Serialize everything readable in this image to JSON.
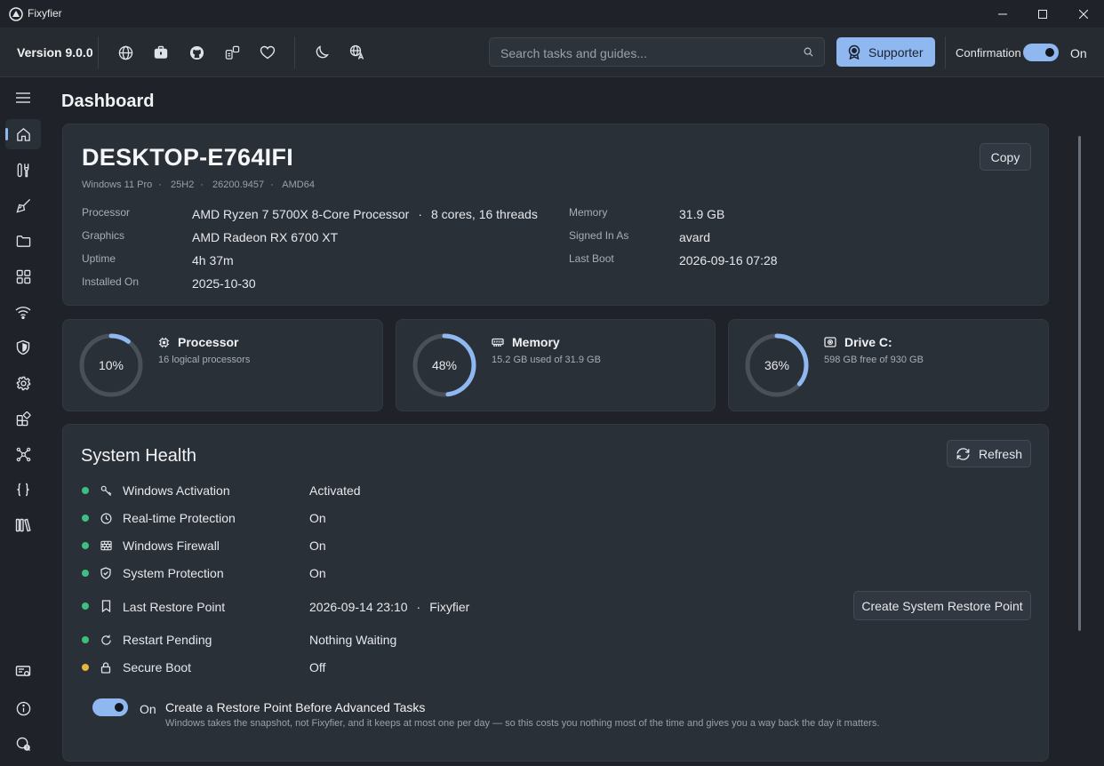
{
  "window": {
    "title": "Fixyfier"
  },
  "toolbar": {
    "version": "Version 9.0.0",
    "search_placeholder": "Search tasks and guides...",
    "supporter_label": "Supporter",
    "confirmation_label": "Confirmation",
    "confirmation_state": "On"
  },
  "page": {
    "title": "Dashboard"
  },
  "system": {
    "hostname": "DESKTOP-E764IFI",
    "os": [
      "Windows 11 Pro",
      "25H2",
      "26200.9457",
      "AMD64"
    ],
    "copy_label": "Copy",
    "processor_label": "Processor",
    "processor_value": "AMD Ryzen 7 5700X 8-Core Processor",
    "processor_extra": "8 cores, 16 threads",
    "graphics_label": "Graphics",
    "graphics_value": "AMD Radeon RX 6700 XT",
    "uptime_label": "Uptime",
    "uptime_value": "4h 37m",
    "installed_label": "Installed On",
    "installed_value": "2025-10-30",
    "memory_label": "Memory",
    "memory_value": "31.9 GB",
    "signed_label": "Signed In As",
    "signed_value": "avard",
    "boot_label": "Last Boot",
    "boot_value": "2026-09-16 07:28"
  },
  "stats": [
    {
      "title": "Processor",
      "subtitle": "16 logical processors",
      "percent_label": "10%",
      "fraction": 0.1,
      "icon": "cpu-icon"
    },
    {
      "title": "Memory",
      "subtitle": "15.2 GB used of 31.9 GB",
      "percent_label": "48%",
      "fraction": 0.48,
      "icon": "memory-icon"
    },
    {
      "title": "Drive C:",
      "subtitle": "598 GB free of 930 GB",
      "percent_label": "36%",
      "fraction": 0.36,
      "icon": "drive-icon"
    }
  ],
  "health": {
    "title": "System Health",
    "refresh_label": "Refresh",
    "restore_button_label": "Create System Restore Point",
    "items": [
      {
        "label": "Windows Activation",
        "value": "Activated",
        "status_color": "#3fbf7f",
        "icon": "key-icon"
      },
      {
        "label": "Real-time Protection",
        "value": "On",
        "status_color": "#3fbf7f",
        "icon": "clock-icon"
      },
      {
        "label": "Windows Firewall",
        "value": "On",
        "status_color": "#3fbf7f",
        "icon": "firewall-icon"
      },
      {
        "label": "System Protection",
        "value": "On",
        "status_color": "#3fbf7f",
        "icon": "shield-check-icon"
      },
      {
        "label": "Last Restore Point",
        "value": "2026-09-14 23:10",
        "extra": "Fixyfier",
        "status_color": "#3fbf7f",
        "icon": "bookmark-icon"
      },
      {
        "label": "Restart Pending",
        "value": "Nothing Waiting",
        "status_color": "#3fbf7f",
        "icon": "restart-icon"
      },
      {
        "label": "Secure Boot",
        "value": "Off",
        "status_color": "#e8b43a",
        "icon": "lock-icon"
      }
    ],
    "advanced_toggle_state": "On",
    "advanced_title": "Create a Restore Point Before Advanced Tasks",
    "advanced_desc": "Windows takes the snapshot, not Fixyfier, and it keeps at most one per day — so this costs you nothing most of the time and gives you a way back the day it matters."
  },
  "colors": {
    "accent": "#8fb8f0",
    "ok": "#3fbf7f",
    "warn": "#e8b43a"
  }
}
